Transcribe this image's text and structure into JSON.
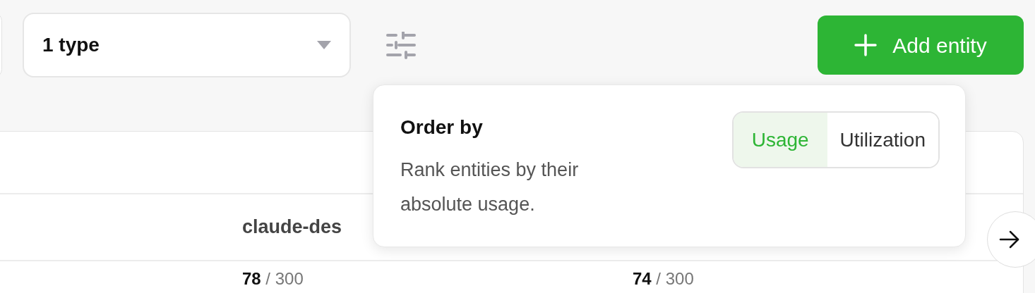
{
  "type_filter": {
    "value": "1 type"
  },
  "add_button": {
    "label": "Add entity"
  },
  "table": {
    "columns": [
      {
        "label": "claude-des"
      }
    ],
    "rows": [
      {
        "cells": [
          "**78** / 300",
          "**74** / 300"
        ]
      }
    ]
  },
  "order_popover": {
    "title": "Order by",
    "description": "Rank entities by their absolute usage.",
    "options": [
      {
        "label": "Usage",
        "selected": true
      },
      {
        "label": "Utilization",
        "selected": false
      }
    ]
  }
}
